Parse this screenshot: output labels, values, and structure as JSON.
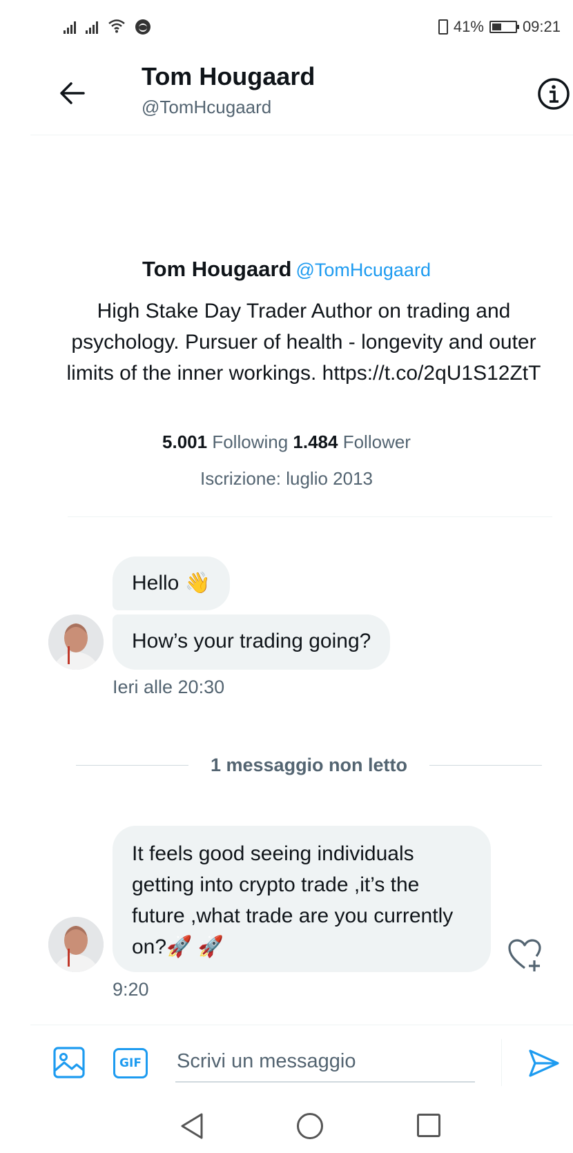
{
  "status_bar": {
    "battery_percent": "41%",
    "battery_level": 0.41,
    "time": "09:21",
    "icons": [
      "signal-icon",
      "signal-icon",
      "wifi-icon",
      "spotify-icon",
      "vibrate-icon",
      "battery-icon"
    ]
  },
  "header": {
    "name": "Tom Hougaard",
    "handle": "@TomHcugaard",
    "back_icon": "arrow-left-icon",
    "info_icon": "info-icon"
  },
  "profile": {
    "name": "Tom Hougaard",
    "handle": "@TomHcugaard",
    "bio": "High Stake Day Trader  Author on trading and psychology.  Pursuer of health - longevity and outer limits of the inner workings. https://t.co/2qU1S12ZtT",
    "following_count": "5.001",
    "following_label": "Following",
    "follower_count": "1.484",
    "follower_label": "Follower",
    "joined": "Iscrizione: luglio 2013"
  },
  "messages": [
    {
      "text": "Hello 👋"
    },
    {
      "text": "How’s your trading going?"
    },
    {
      "text": "It feels good seeing individuals getting into crypto trade ,it’s the future ,what trade are you currently on?🚀 🚀"
    }
  ],
  "timestamps": {
    "first_group": "Ieri alle 20:30",
    "second_group": "9:20"
  },
  "unread_divider": "1 messaggio non letto",
  "composer": {
    "placeholder": "Scrivi un messaggio",
    "value": "",
    "gif_label": "GIF",
    "media_icon": "image-icon",
    "send_icon": "send-icon"
  },
  "colors": {
    "accent": "#1d9bf0",
    "bubble": "#eff3f4",
    "text": "#0f1419",
    "secondary_text": "#536471"
  }
}
